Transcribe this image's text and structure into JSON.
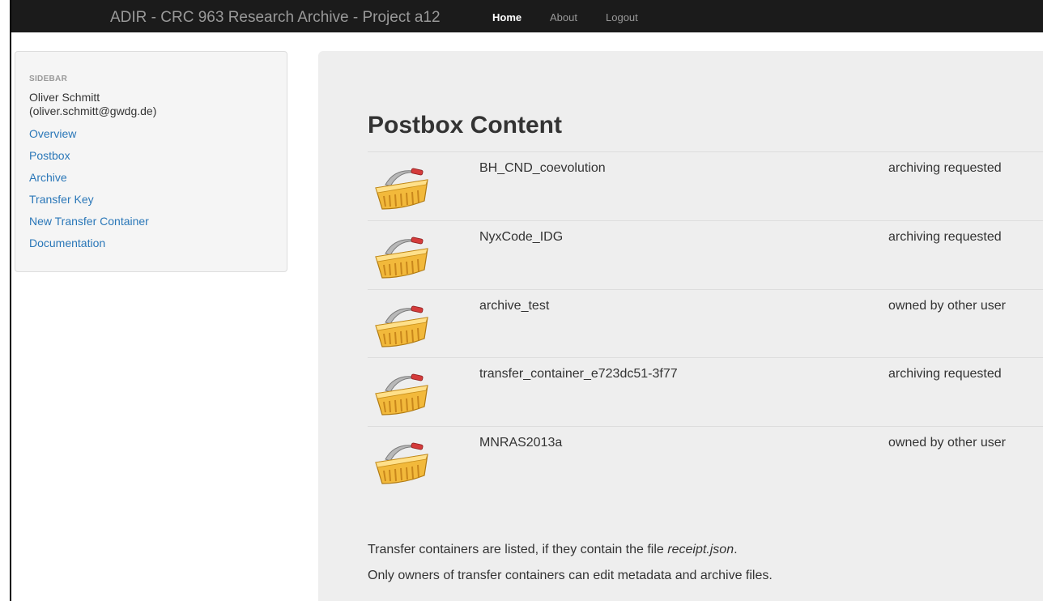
{
  "navbar": {
    "brand": "ADIR - CRC 963 Research Archive - Project a12",
    "links": [
      {
        "label": "Home",
        "active": true
      },
      {
        "label": "About",
        "active": false
      },
      {
        "label": "Logout",
        "active": false
      }
    ]
  },
  "sidebar": {
    "header": "SIDEBAR",
    "user_name": "Oliver Schmitt",
    "user_email": "(oliver.schmitt@gwdg.de)",
    "items": [
      {
        "label": "Overview"
      },
      {
        "label": "Postbox"
      },
      {
        "label": "Archive"
      },
      {
        "label": "Transfer Key"
      },
      {
        "label": "New Transfer Container"
      },
      {
        "label": "Documentation"
      }
    ]
  },
  "main": {
    "title": "Postbox Content",
    "containers": [
      {
        "icon": "basket-icon",
        "name": "BH_CND_coevolution",
        "status": "archiving requested"
      },
      {
        "icon": "basket-icon",
        "name": "NyxCode_IDG",
        "status": "archiving requested"
      },
      {
        "icon": "basket-icon",
        "name": "archive_test",
        "status": "owned by other user"
      },
      {
        "icon": "basket-icon",
        "name": "transfer_container_e723dc51-3f77",
        "status": "archiving requested"
      },
      {
        "icon": "basket-icon",
        "name": "MNRAS2013a",
        "status": "owned by other user"
      }
    ],
    "note_line1_prefix": "Transfer containers are listed, if they contain the file ",
    "note_line1_file": "receipt.json",
    "note_line1_suffix": ".",
    "note_line2": "Only owners of transfer containers can edit metadata and archive files."
  },
  "colors": {
    "navbar_bg": "#1b1b1b",
    "link": "#2a77b8",
    "main_bg": "#eeeeee",
    "sidebar_bg": "#f5f5f5"
  }
}
